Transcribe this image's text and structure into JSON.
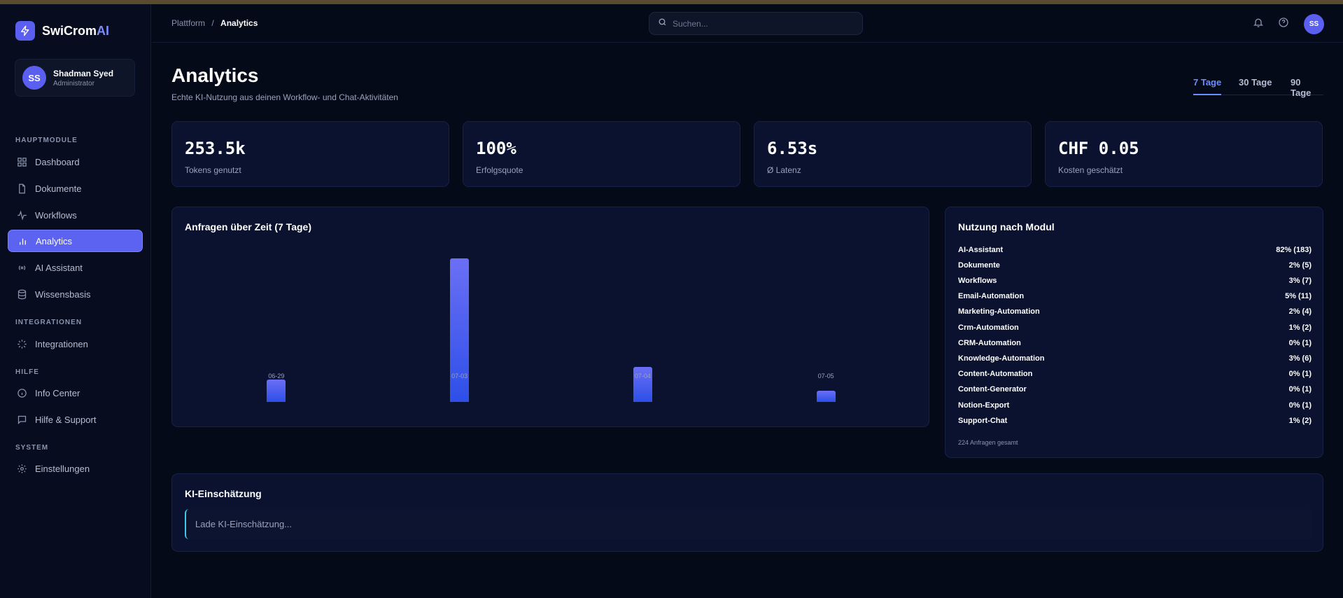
{
  "app": {
    "name_main": "SwiCrom",
    "name_accent": "AI"
  },
  "user": {
    "initials": "SS",
    "name": "Shadman Syed",
    "role": "Administrator"
  },
  "sidebar": {
    "sections": [
      {
        "label": "HAUPTMODULE"
      },
      {
        "label": "INTEGRATIONEN"
      },
      {
        "label": "HILFE"
      },
      {
        "label": "SYSTEM"
      }
    ],
    "items": [
      {
        "label": "Dashboard",
        "icon": "grid-icon"
      },
      {
        "label": "Dokumente",
        "icon": "document-icon"
      },
      {
        "label": "Workflows",
        "icon": "activity-icon"
      },
      {
        "label": "Analytics",
        "icon": "bar-chart-icon",
        "active": true
      },
      {
        "label": "AI Assistant",
        "icon": "radio-icon"
      },
      {
        "label": "Wissensbasis",
        "icon": "database-icon"
      },
      {
        "label": "Integrationen",
        "icon": "loader-icon"
      },
      {
        "label": "Info Center",
        "icon": "info-icon"
      },
      {
        "label": "Hilfe & Support",
        "icon": "message-icon"
      },
      {
        "label": "Einstellungen",
        "icon": "gear-icon"
      }
    ]
  },
  "header": {
    "breadcrumb": {
      "root": "Plattform",
      "separator": "/",
      "current": "Analytics"
    },
    "search": {
      "placeholder": "Suchen..."
    },
    "avatar_initials": "SS"
  },
  "page": {
    "title": "Analytics",
    "subtitle": "Echte KI-Nutzung aus deinen Workflow- und Chat-Aktivitäten",
    "range_tabs": [
      {
        "label": "7 Tage",
        "active": true
      },
      {
        "label": "30 Tage"
      },
      {
        "label": "90 Tage"
      }
    ]
  },
  "stats": [
    {
      "value": "253.5k",
      "label": "Tokens genutzt"
    },
    {
      "value": "100%",
      "label": "Erfolgsquote"
    },
    {
      "value": "6.53s",
      "label": "Ø Latenz"
    },
    {
      "value": "CHF 0.05",
      "label": "Kosten geschätzt"
    }
  ],
  "requests_panel": {
    "title": "Anfragen über Zeit (7 Tage)"
  },
  "chart_data": {
    "type": "bar",
    "title": "Anfragen über Zeit (7 Tage)",
    "categories": [
      "06-29",
      "07-03",
      "07-04",
      "07-05"
    ],
    "values": [
      26,
      168,
      41,
      13
    ],
    "ylim": [
      0,
      168
    ],
    "grid": false,
    "colors": {
      "bar_top": "#6b6ff5",
      "bar_bottom": "#2d4fe8"
    }
  },
  "modules_panel": {
    "title": "Nutzung nach Modul",
    "rows": [
      {
        "name": "AI-Assistant",
        "value": "82% (183)"
      },
      {
        "name": "Dokumente",
        "value": "2% (5)"
      },
      {
        "name": "Workflows",
        "value": "3% (7)"
      },
      {
        "name": "Email-Automation",
        "value": "5% (11)"
      },
      {
        "name": "Marketing-Automation",
        "value": "2% (4)"
      },
      {
        "name": "Crm-Automation",
        "value": "1% (2)"
      },
      {
        "name": "CRM-Automation",
        "value": "0% (1)"
      },
      {
        "name": "Knowledge-Automation",
        "value": "3% (6)"
      },
      {
        "name": "Content-Automation",
        "value": "0% (1)"
      },
      {
        "name": "Content-Generator",
        "value": "0% (1)"
      },
      {
        "name": "Notion-Export",
        "value": "0% (1)"
      },
      {
        "name": "Support-Chat",
        "value": "1% (2)"
      }
    ],
    "total": "224 Anfragen gesamt"
  },
  "ki_panel": {
    "title": "KI-Einschätzung",
    "loading_text": "Lade KI-Einschätzung..."
  },
  "colors": {
    "accent": "#5b5ff0",
    "background": "#050a18",
    "panel": "#0a1230",
    "tab_active": "#6d8dff",
    "ki_border": "#3ec9ea"
  }
}
